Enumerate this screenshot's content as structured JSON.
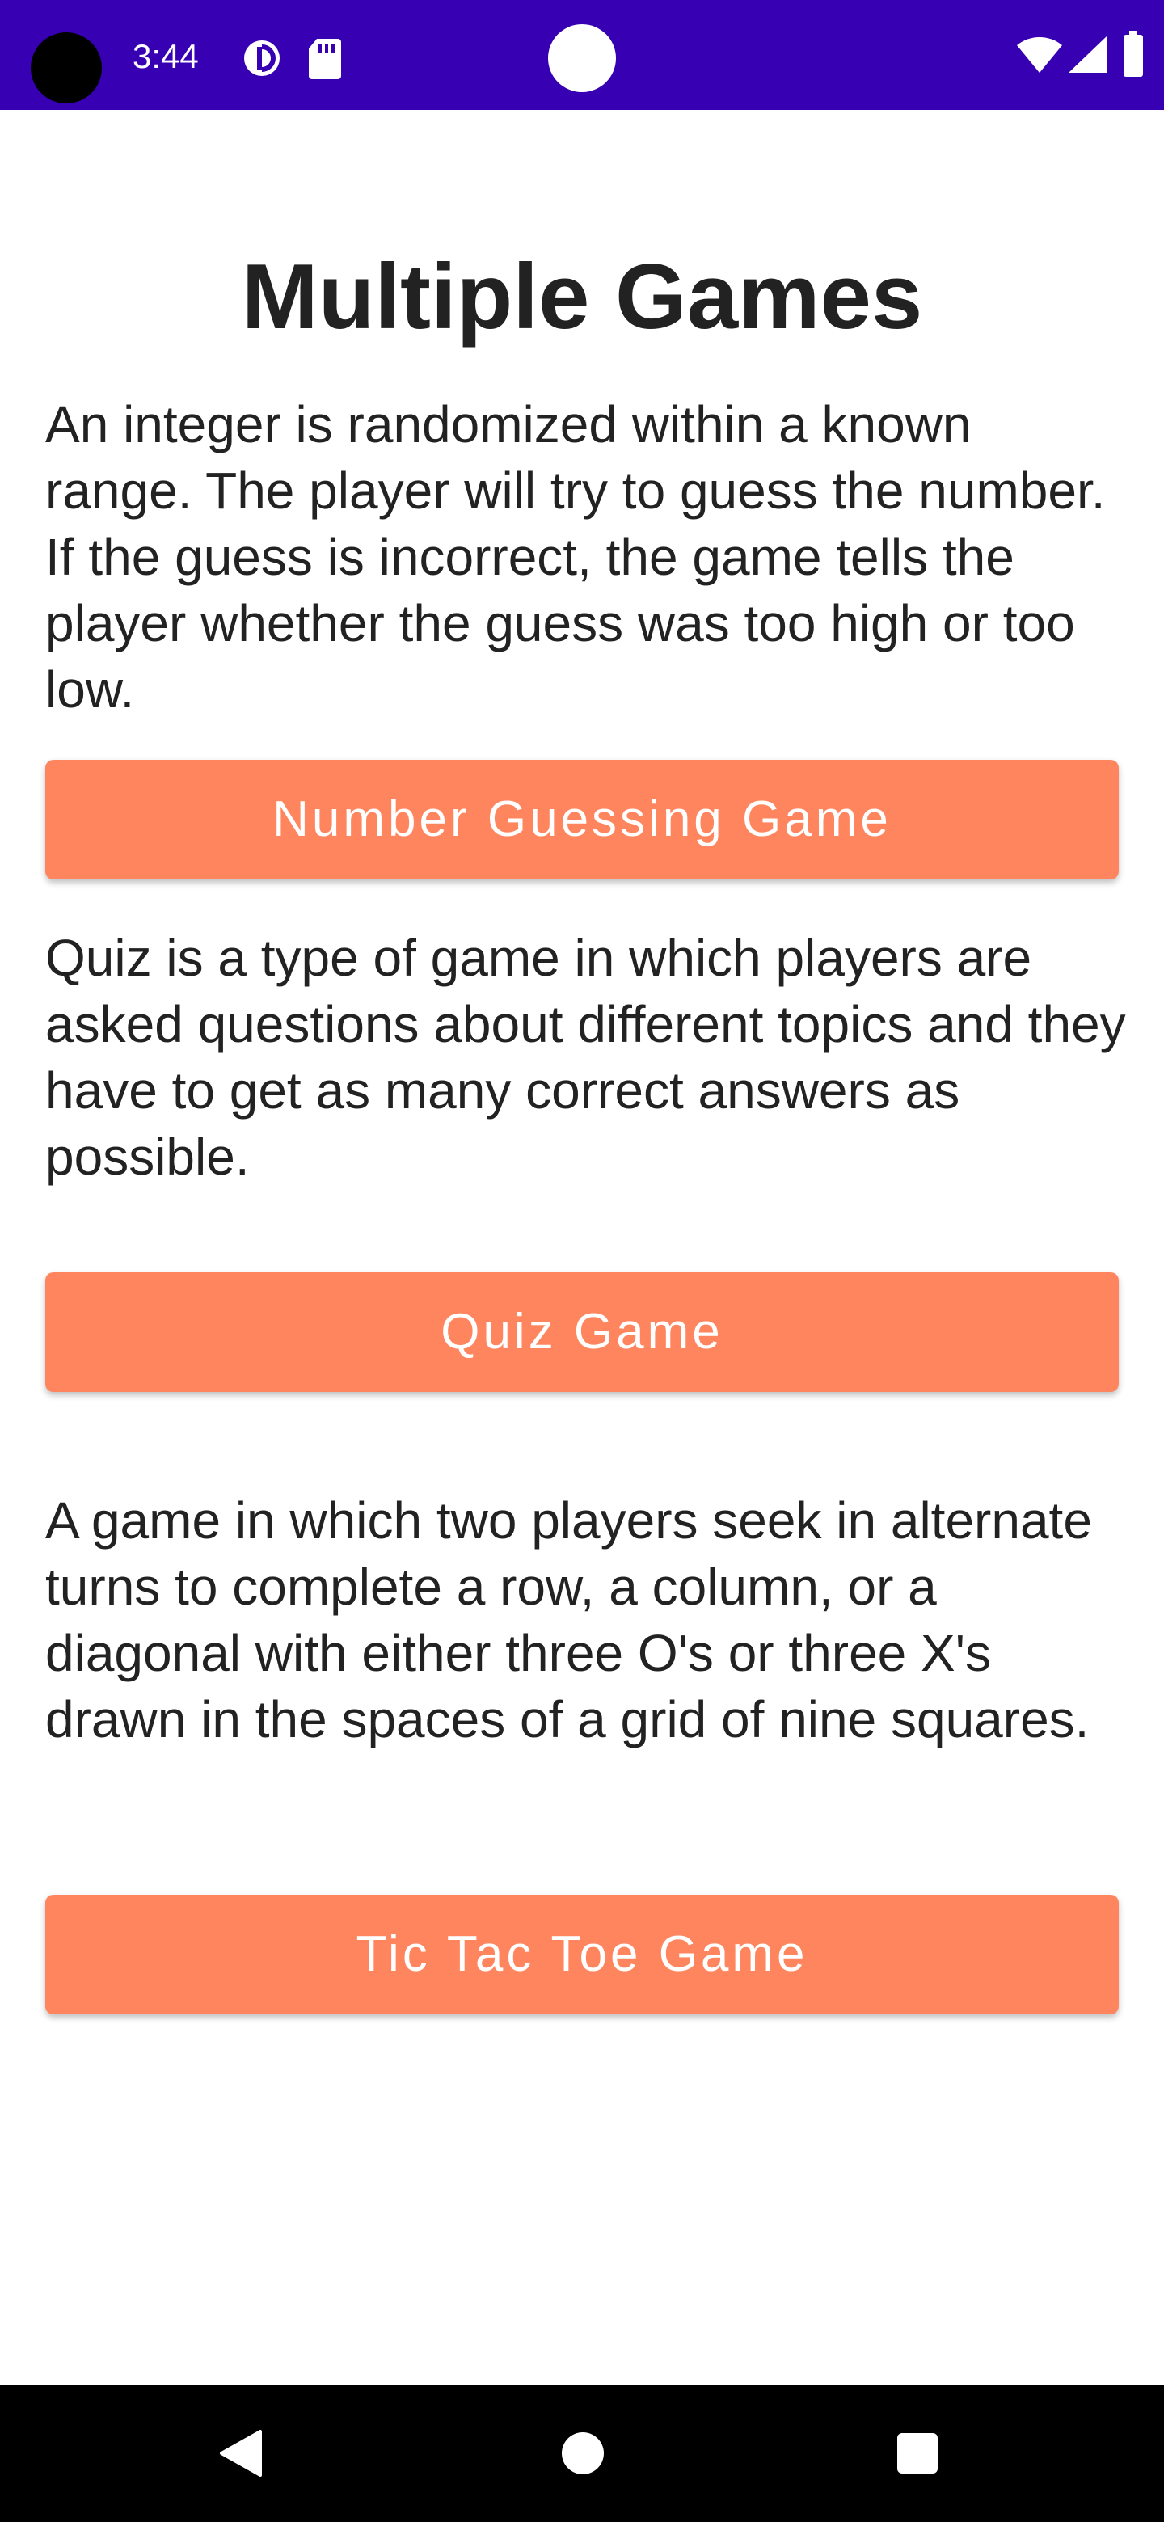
{
  "status_bar": {
    "time": "3:44",
    "background_color": "#3700B3",
    "icons": [
      "camera-cutout",
      "data-saver-icon",
      "sd-card-icon",
      "wifi-icon",
      "signal-icon",
      "battery-icon"
    ]
  },
  "main": {
    "title": "Multiple Games",
    "sections": [
      {
        "description": "An integer is randomized within a known range. The player will try to guess the number. If the guess is incorrect, the game tells the player whether the guess was too high or too low.",
        "button_label": "Number Guessing Game"
      },
      {
        "description": "Quiz is a type of game in which players are asked questions about different topics and they have to get as many correct answers as possible.",
        "button_label": "Quiz Game"
      },
      {
        "description": "A game in which two players seek in alternate turns to complete a row, a column, or a diagonal with either three O's or three X's drawn in the spaces of a grid of nine squares.",
        "button_label": "Tic Tac Toe Game"
      }
    ],
    "button_color": "#FF855E"
  },
  "nav_bar": {
    "buttons": [
      "back-icon",
      "home-icon",
      "recents-icon"
    ]
  }
}
